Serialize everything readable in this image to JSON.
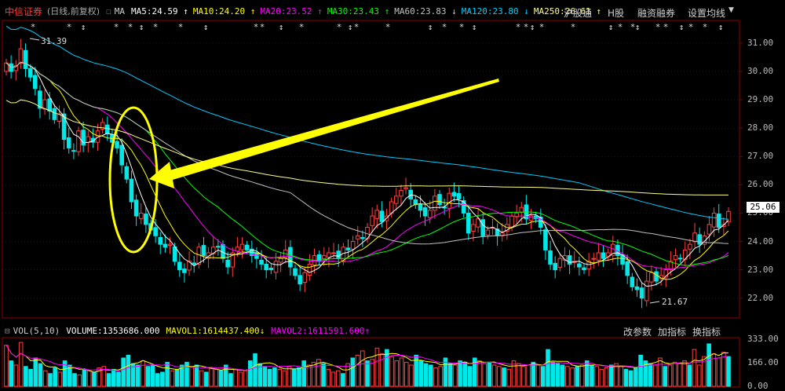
{
  "header": {
    "stock_name": "中信证券",
    "period_label": "(日线,前复权)",
    "ma_label": "MA",
    "ma_items": [
      {
        "label": "MA5:24.59",
        "arrow": "↑",
        "color": "#ffffff"
      },
      {
        "label": "MA10:24.20",
        "arrow": "↑",
        "color": "#ffff00"
      },
      {
        "label": "MA20:23.52",
        "arrow": "↑",
        "color": "#ff00ff"
      },
      {
        "label": "MA30:23.43",
        "arrow": "↑",
        "color": "#00ff00"
      },
      {
        "label": "MA60:23.83",
        "arrow": "↓",
        "color": "#c0c0c0"
      },
      {
        "label": "MA120:23.80",
        "arrow": "↓",
        "color": "#00ccff"
      },
      {
        "label": "MA250:26.61",
        "arrow": "↑",
        "color": "#ffff88"
      }
    ],
    "buttons": [
      "沪股通",
      "H股",
      "融资融券",
      "设置均线"
    ]
  },
  "volume_header": {
    "title": "VOL(5,10)",
    "volume": "VOLUME:1353686.000",
    "mavol1": "MAVOL1:1614437.400",
    "mavol1_arrow": "↓",
    "mavol2": "MAVOL2:1611591.600",
    "mavol2_arrow": "↑",
    "buttons": [
      "改参数",
      "加指标",
      "换指标"
    ]
  },
  "colors": {
    "up": "#ff4040",
    "down": "#00e8e8",
    "background": "#000000",
    "grid": "#8b0000",
    "highlight": "#ffff00"
  },
  "chart_data": [
    {
      "type": "candlestick",
      "yticks": [
        "31.00",
        "30.00",
        "29.00",
        "28.00",
        "27.00",
        "26.00",
        "25.00",
        "24.00",
        "23.00",
        "22.00"
      ],
      "ylim": [
        21.3,
        31.8
      ],
      "current_price": "25.06",
      "annotations": {
        "high": "31.39",
        "low": "21.67"
      },
      "closes": [
        30.3,
        30.0,
        30.2,
        30.8,
        30.1,
        29.8,
        29.4,
        28.7,
        29.0,
        28.6,
        28.3,
        28.5,
        27.6,
        27.3,
        27.2,
        27.9,
        27.4,
        27.7,
        27.5,
        27.9,
        28.2,
        27.8,
        27.5,
        27.3,
        26.7,
        26.2,
        25.4,
        24.9,
        25.0,
        24.6,
        24.4,
        24.2,
        23.9,
        23.8,
        23.9,
        23.3,
        23.0,
        22.9,
        23.3,
        23.2,
        23.8,
        23.5,
        23.6,
        23.8,
        23.8,
        23.4,
        23.1,
        23.6,
        23.8,
        23.9,
        23.7,
        23.5,
        23.4,
        23.2,
        23.0,
        23.0,
        23.3,
        23.4,
        23.7,
        23.1,
        22.8,
        22.5,
        22.9,
        23.2,
        23.5,
        23.3,
        23.5,
        23.6,
        23.6,
        23.4,
        23.8,
        23.7,
        24.0,
        24.2,
        24.1,
        24.5,
        24.9,
        25.1,
        24.7,
        24.9,
        25.4,
        25.6,
        25.8,
        25.9,
        25.5,
        25.3,
        25.1,
        24.9,
        25.1,
        25.6,
        25.3,
        25.2,
        25.7,
        25.6,
        25.5,
        25.0,
        24.3,
        24.6,
        24.8,
        24.2,
        24.4,
        24.5,
        24.2,
        24.3,
        24.6,
        24.9,
        25.0,
        25.2,
        24.8,
        24.9,
        24.8,
        24.5,
        23.7,
        23.2,
        23.0,
        23.4,
        23.5,
        23.2,
        23.3,
        23.1,
        23.0,
        23.3,
        23.4,
        23.6,
        23.4,
        23.6,
        23.9,
        23.5,
        23.2,
        22.8,
        22.4,
        22.3,
        22.0,
        22.6,
        22.9,
        22.6,
        22.8,
        23.0,
        23.3,
        23.5,
        23.4,
        23.7,
        23.9,
        24.3,
        23.9,
        24.2,
        24.6,
        25.0,
        24.5,
        24.6,
        25.06
      ],
      "ma_periods": [
        5,
        10,
        20,
        30,
        60,
        120,
        250
      ]
    },
    {
      "type": "bar",
      "name": "VOL(5,10)",
      "yticks": [
        "333.00",
        "166.00",
        "0.00"
      ],
      "ylim": [
        0,
        333
      ],
      "values": [
        290,
        180,
        150,
        310,
        140,
        120,
        200,
        160,
        110,
        90,
        130,
        100,
        180,
        150,
        90,
        80,
        120,
        110,
        100,
        130,
        140,
        90,
        120,
        100,
        200,
        220,
        160,
        150,
        180,
        140,
        150,
        90,
        100,
        170,
        110,
        120,
        150,
        170,
        140,
        150,
        110,
        100,
        130,
        120,
        110,
        150,
        90,
        120,
        100,
        110,
        180,
        230,
        160,
        140,
        120,
        130,
        120,
        110,
        140,
        120,
        130,
        180,
        150,
        170,
        190,
        160,
        120,
        100,
        110,
        90,
        160,
        200,
        220,
        250,
        180,
        190,
        270,
        230,
        260,
        210,
        180,
        200,
        170,
        150,
        220,
        180,
        160,
        150,
        130,
        140,
        200,
        160,
        150,
        180,
        170,
        140,
        200,
        180,
        160,
        170,
        150,
        140,
        130,
        120,
        180,
        160,
        140,
        150,
        170,
        150,
        140,
        260,
        170,
        160,
        150,
        140,
        130,
        140,
        150,
        180,
        150,
        140,
        120,
        130,
        150,
        160,
        140,
        120,
        110,
        130,
        220,
        180,
        160,
        150,
        200,
        140,
        150,
        170,
        160,
        180,
        150,
        260,
        150,
        210,
        300,
        230,
        200,
        240,
        210
      ]
    }
  ]
}
